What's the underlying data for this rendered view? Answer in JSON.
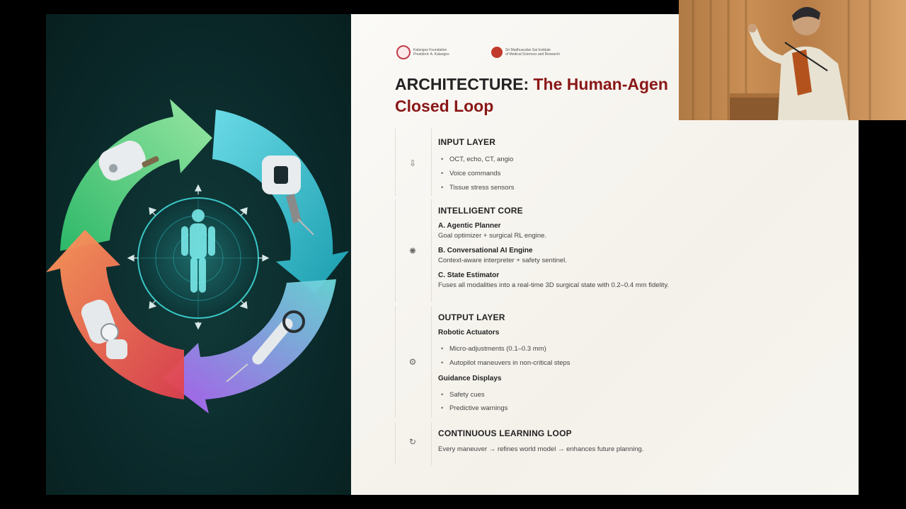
{
  "logos": [
    {
      "name": "Kalangos Foundation",
      "line1": "Kalangos Foundation",
      "line2": "President: A. Kalangos",
      "color": "#c23b4a"
    },
    {
      "name": "Sri Madhusudan Sai Institute",
      "line1": "Sri Madhusudan Sai Institute",
      "line2": "of Medical Sciences and Research",
      "color": "#c0392b"
    }
  ],
  "title": {
    "prefix": "ARCHITECTURE: ",
    "accent": "The Human-Agen",
    "line2": "Closed Loop"
  },
  "input_layer": {
    "title": "INPUT LAYER",
    "icon": "download-icon",
    "bullets": [
      "OCT, echo, CT, angio",
      "Voice commands",
      "Tissue stress sensors"
    ]
  },
  "intelligent_core": {
    "title": "INTELLIGENT CORE",
    "icon": "brain-icon",
    "items": [
      {
        "heading": "A. Agentic Planner",
        "text": "Goal optimizer + surgical RL engine."
      },
      {
        "heading": "B. Conversational AI Engine",
        "text": "Context-aware interpreter + safety sentinel."
      },
      {
        "heading": "C. State Estimator",
        "text": "Fuses all modalities into a real-time 3D surgical state with 0.2–0.4 mm fidelity."
      }
    ]
  },
  "output_layer": {
    "title": "OUTPUT LAYER",
    "icon": "robot-arm-icon",
    "actuators_heading": "Robotic Actuators",
    "actuators": [
      "Micro-adjustments (0.1–0.3 mm)",
      "Autopilot maneuvers in non-critical steps"
    ],
    "guidance_heading": "Guidance Displays",
    "guidance": [
      "Safety cues",
      "Predictive warnings"
    ]
  },
  "learning_loop": {
    "title": "CONTINUOUS LEARNING LOOP",
    "icon": "refresh-icon",
    "text": "Every maneuver → refines world model → enhances future planning."
  },
  "colors": {
    "accent": "#8a1717",
    "arrow_green": "#3fd17a",
    "arrow_teal": "#3cc8d6",
    "arrow_purple": "#a05cf0",
    "arrow_orange": "#ef5a4a"
  }
}
